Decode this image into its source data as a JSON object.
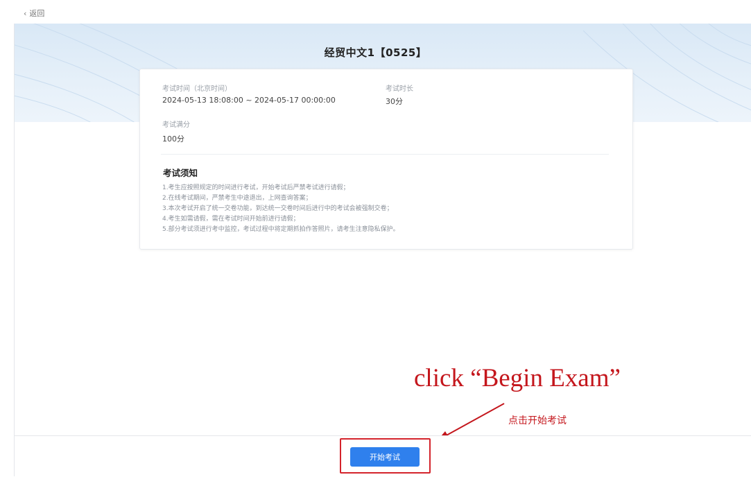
{
  "nav": {
    "back_label": "返回"
  },
  "exam": {
    "title": "经贸中文1【0525】",
    "time_label": "考试时间（北京时间）",
    "time_value": "2024-05-13 18:08:00 ~ 2024-05-17 00:00:00",
    "duration_label": "考试时长",
    "duration_value": "30分",
    "full_score_label": "考试满分",
    "full_score_value": "100分"
  },
  "notice": {
    "title": "考试须知",
    "items": [
      "1.考生应按照规定的时间进行考试，开始考试后严禁考试进行请假；",
      "2.在线考试期间，严禁考生中途退出，上网查询答案；",
      "3.本次考试开启了统一交卷功能，到达统一交卷时间后进行中的考试会被强制交卷；",
      "4.考生如需请假，需在考试时间开始前进行请假；",
      "5.部分考试须进行考中监控，考试过程中将定期抓拍作答照片，请考生注意隐私保护。"
    ]
  },
  "annotation": {
    "english": "click “Begin Exam”",
    "chinese": "点击开始考试",
    "color": "#c4161c"
  },
  "footer": {
    "start_button_label": "开始考试"
  },
  "colors": {
    "accent": "#2f80ed",
    "banner": "#d9e8f6",
    "highlight": "#d4232b"
  }
}
